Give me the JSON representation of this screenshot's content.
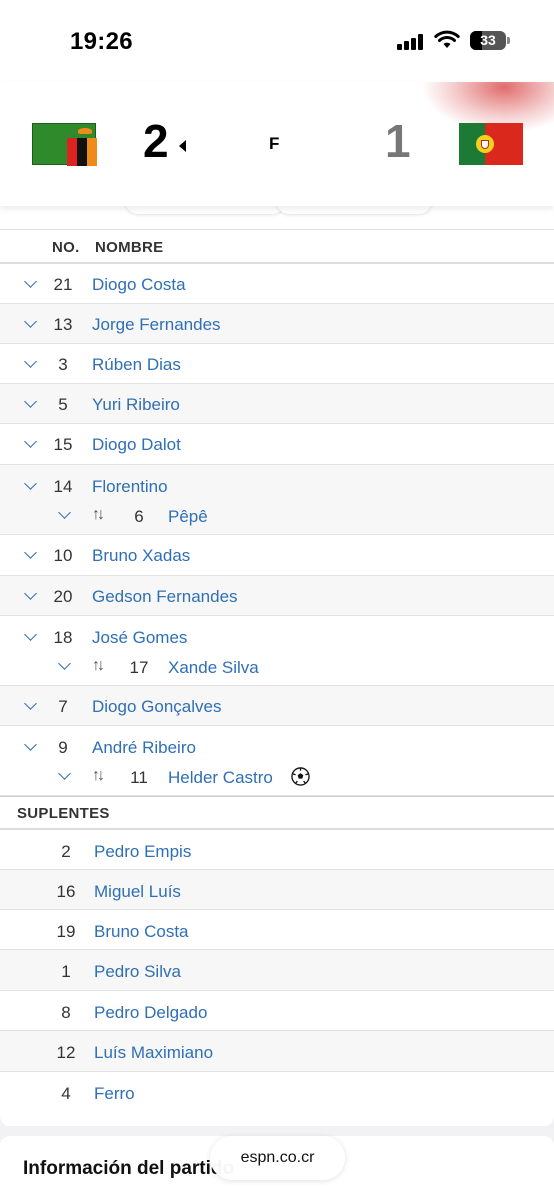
{
  "status_bar": {
    "time": "19:26",
    "battery": "33"
  },
  "match": {
    "home_score": "2",
    "away_score": "1",
    "status": "F",
    "home_flag": "zambia-flag-icon",
    "away_flag": "portugal-flag-icon"
  },
  "lineup": {
    "col_no": "NO.",
    "col_name": "NOMBRE",
    "starters": [
      {
        "no": "21",
        "name": "Diogo Costa"
      },
      {
        "no": "13",
        "name": "Jorge Fernandes"
      },
      {
        "no": "3",
        "name": "Rúben Dias"
      },
      {
        "no": "5",
        "name": "Yuri Ribeiro"
      },
      {
        "no": "15",
        "name": "Diogo Dalot"
      },
      {
        "no": "14",
        "name": "Florentino",
        "sub": {
          "no": "6",
          "name": "Pêpê"
        }
      },
      {
        "no": "10",
        "name": "Bruno Xadas"
      },
      {
        "no": "20",
        "name": "Gedson Fernandes"
      },
      {
        "no": "18",
        "name": "José Gomes",
        "sub": {
          "no": "17",
          "name": "Xande Silva"
        }
      },
      {
        "no": "7",
        "name": "Diogo Gonçalves"
      },
      {
        "no": "9",
        "name": "André Ribeiro",
        "sub": {
          "no": "11",
          "name": "Helder Castro",
          "icon": "soccer-ball-icon"
        }
      }
    ],
    "subs_header": "SUPLENTES",
    "subs": [
      {
        "no": "2",
        "name": "Pedro Empis"
      },
      {
        "no": "16",
        "name": "Miguel Luís"
      },
      {
        "no": "19",
        "name": "Bruno Costa"
      },
      {
        "no": "1",
        "name": "Pedro Silva"
      },
      {
        "no": "8",
        "name": "Pedro Delgado"
      },
      {
        "no": "12",
        "name": "Luís Maximiano"
      },
      {
        "no": "4",
        "name": "Ferro"
      }
    ]
  },
  "swap_glyph": "↑↓",
  "info": {
    "title": "Información del partido"
  },
  "browser": {
    "url": "espn.co.cr"
  },
  "colors": {
    "link": "#2f6fb5",
    "alt_row": "#f7f7f8"
  }
}
